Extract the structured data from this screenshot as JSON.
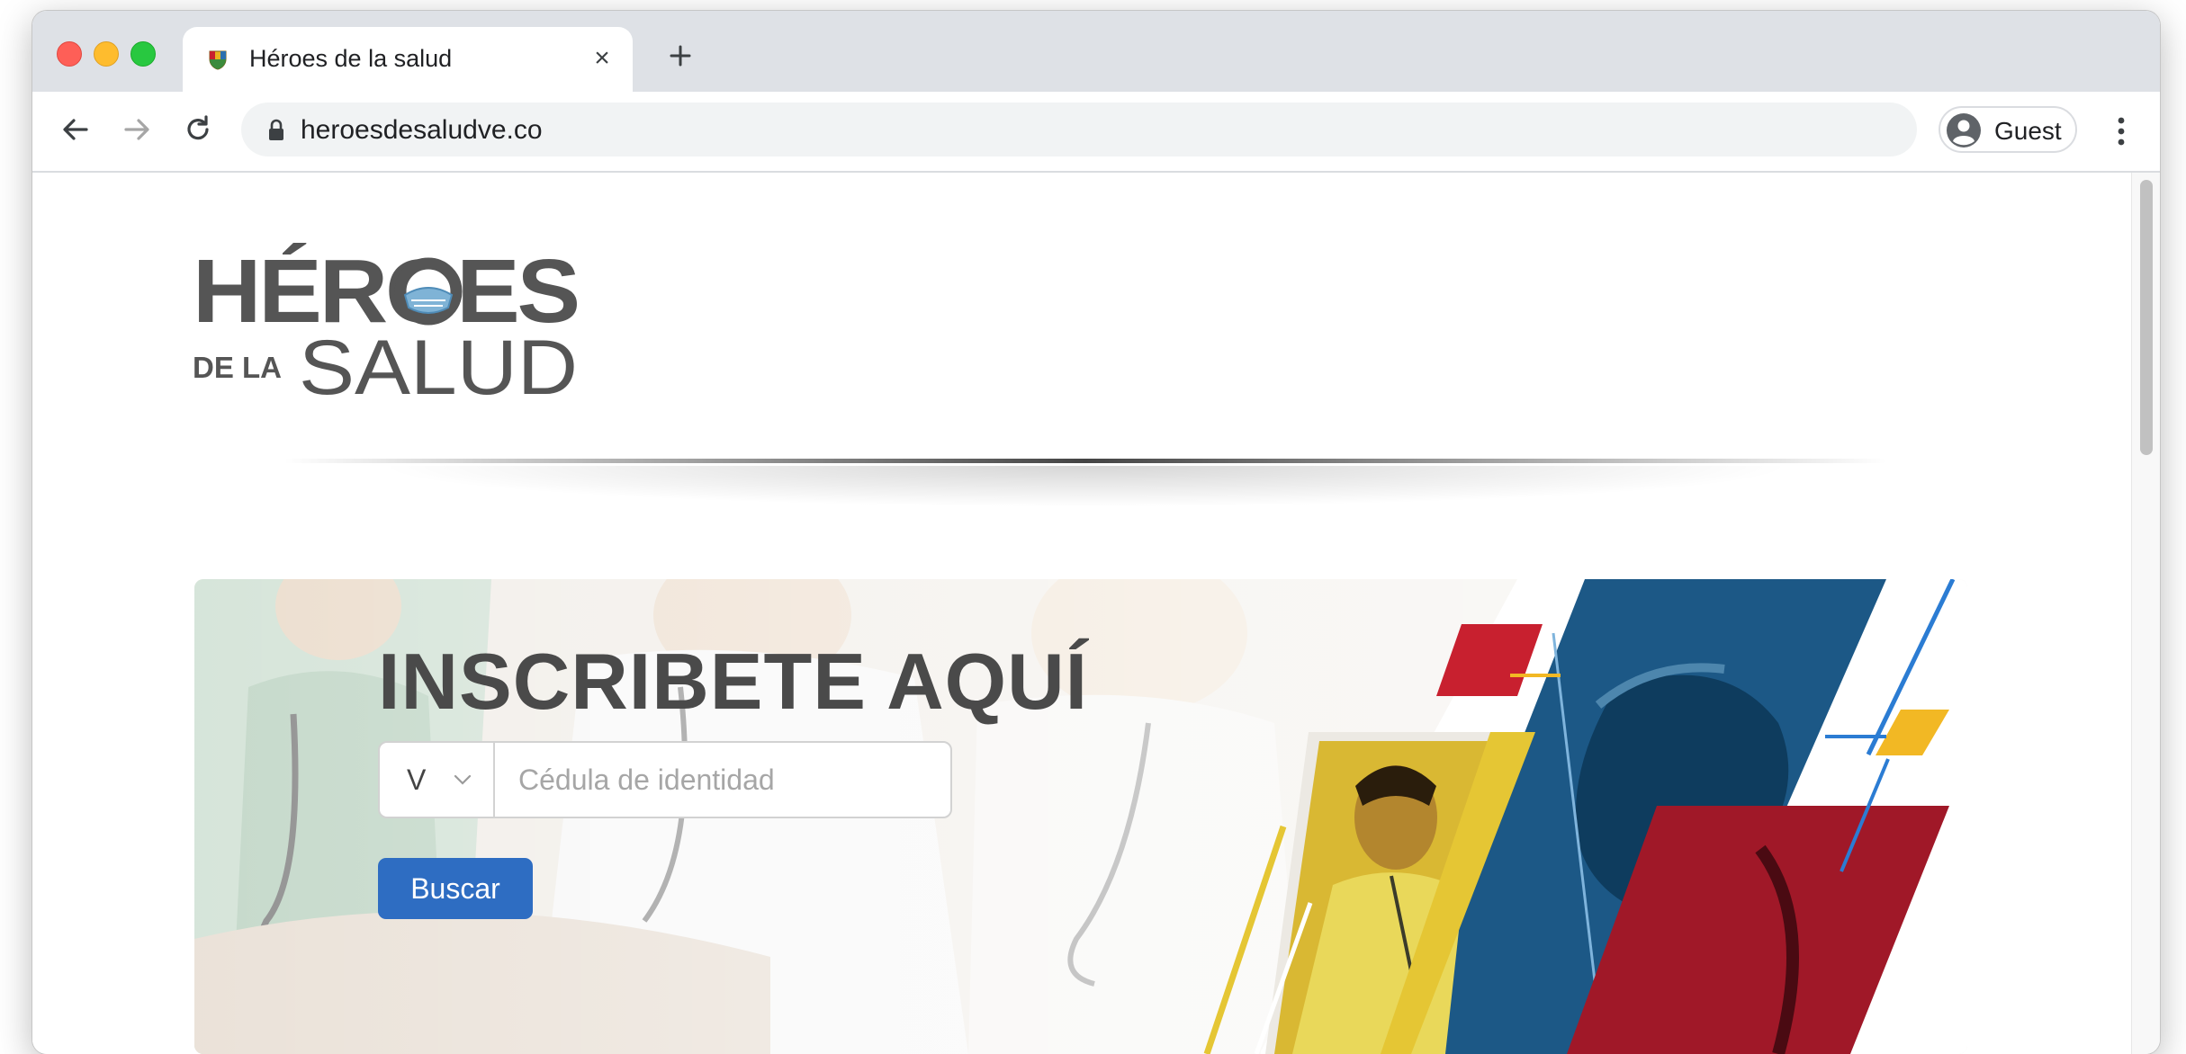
{
  "browser": {
    "tab": {
      "title": "Héroes de la salud"
    },
    "address_bar": {
      "url": "heroesdesaludve.co"
    },
    "profile": {
      "label": "Guest"
    }
  },
  "page": {
    "logo": {
      "line1": "HÉROES",
      "line2_prefix": "DE LA",
      "line2_main": "SALUD"
    },
    "hero": {
      "heading": "INSCRIBETE AQUÍ",
      "doc_type": {
        "selected": "V"
      },
      "cedula": {
        "placeholder": "Cédula de identidad",
        "value": ""
      },
      "search_button": {
        "label": "Buscar"
      }
    }
  },
  "colors": {
    "accent_blue": "#2e6dc2",
    "flag_red": "#c8202f",
    "flag_yellow": "#f2b824",
    "navy": "#1a5a8c",
    "heading_gray": "#4a4a4a"
  }
}
